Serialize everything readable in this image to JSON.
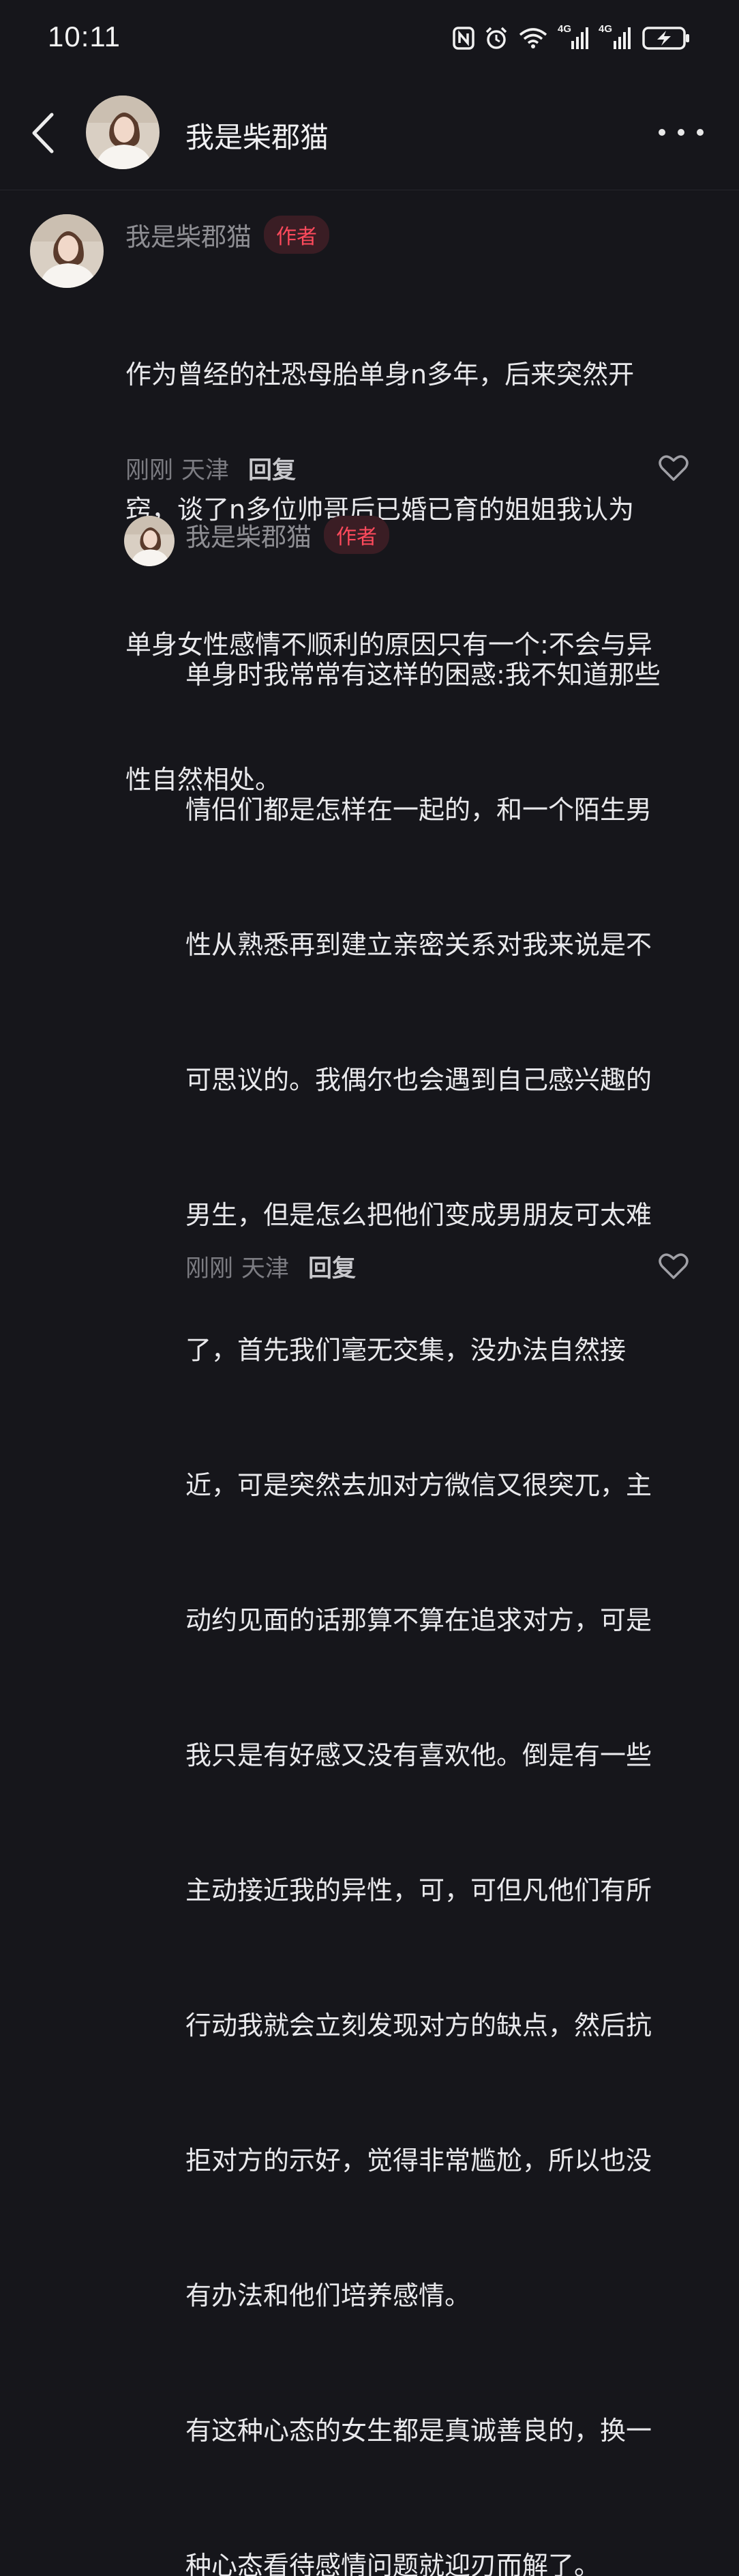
{
  "status_bar": {
    "time": "10:11",
    "icons": [
      "nfc-icon",
      "alarm-icon",
      "wifi-icon",
      "signal-4g-icon",
      "signal-4g-icon",
      "battery-charging-icon"
    ],
    "network_labels": [
      "4G",
      "4G"
    ]
  },
  "header": {
    "title": "我是柴郡猫"
  },
  "comments": [
    {
      "author": "我是柴郡猫",
      "tag": "作者",
      "lines": [
        "作为曾经的社恐母胎单身n多年，后来突然开",
        "窍，谈了n多位帅哥后已婚已育的姐姐我认为",
        "单身女性感情不顺利的原因只有一个:不会与异",
        "性自然相处。"
      ],
      "time": "刚刚",
      "location": "天津",
      "reply_label": "回复"
    },
    {
      "author": "我是柴郡猫",
      "tag": "作者",
      "lines": [
        "单身时我常常有这样的困惑:我不知道那些",
        "情侣们都是怎样在一起的，和一个陌生男",
        "性从熟悉再到建立亲密关系对我来说是不",
        "可思议的。我偶尔也会遇到自己感兴趣的",
        "男生，但是怎么把他们变成男朋友可太难",
        "了，首先我们毫无交集，没办法自然接",
        "近，可是突然去加对方微信又很突兀，主",
        "动约见面的话那算不算在追求对方，可是",
        "我只是有好感又没有喜欢他。倒是有一些",
        "主动接近我的异性，可，可但凡他们有所",
        "行动我就会立刻发现对方的缺点，然后抗",
        "拒对方的示好，觉得非常尴尬，所以也没",
        "有办法和他们培养感情。",
        "有这种心态的女生都是真诚善良的，换一",
        "种心态看待感情问题就迎刃而解了。"
      ],
      "time": "刚刚",
      "location": "天津",
      "reply_label": "回复"
    }
  ],
  "colors": {
    "background": "#16161b",
    "author_tag_text": "#ff4a5c",
    "author_tag_bg": "#3a1d24"
  }
}
